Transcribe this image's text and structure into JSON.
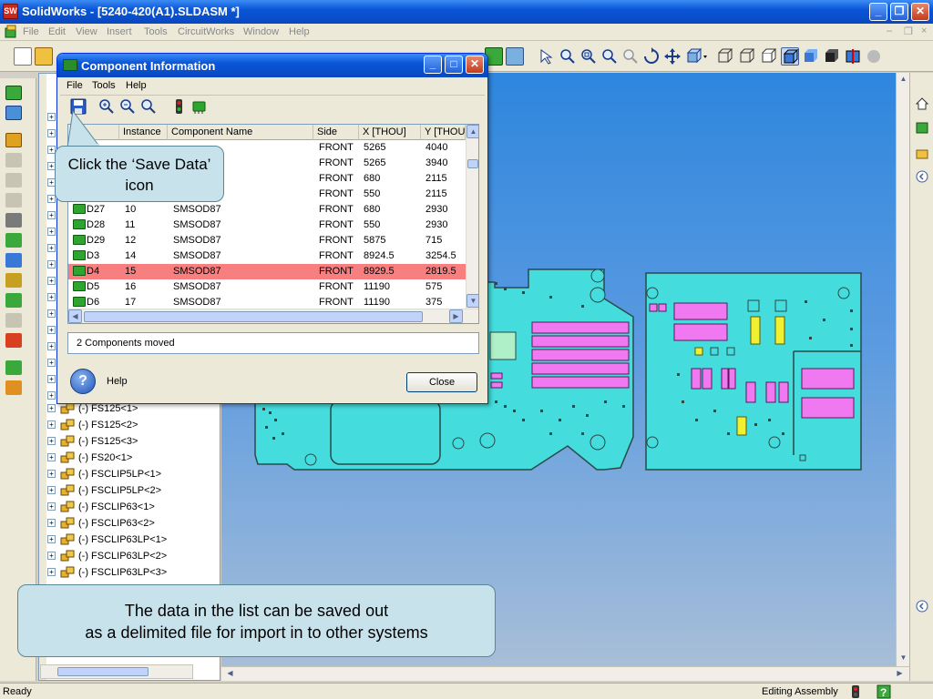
{
  "window": {
    "app_icon_text": "SW",
    "title": "SolidWorks - [5240-420(A1).SLDASM *]"
  },
  "menubar": {
    "items": [
      "File",
      "Edit",
      "View",
      "Insert",
      "Tools",
      "CircuitWorks",
      "Window",
      "Help"
    ]
  },
  "tree": {
    "items": [
      "(-) FS125<1>",
      "(-) FS125<2>",
      "(-) FS125<3>",
      "(-) FS20<1>",
      "(-) FSCLIP5LP<1>",
      "(-) FSCLIP5LP<2>",
      "(-) FSCLIP63<1>",
      "(-) FSCLIP63<2>",
      "(-) FSCLIP63LP<1>",
      "(-) FSCLIP63LP<2>",
      "(-) FSCLIP63LP<3>"
    ]
  },
  "dialog": {
    "title": "Component Information",
    "menu": [
      "File",
      "Tools",
      "Help"
    ],
    "columns": [
      "R",
      "Instance",
      "Component Name",
      "Side",
      "X [THOU]",
      "Y [THOU"
    ],
    "rows": [
      {
        "ref": "D27",
        "instance": "10",
        "name": "SMSOD87",
        "side": "FRONT",
        "x": "680",
        "y": "2930"
      },
      {
        "ref": "D28",
        "instance": "11",
        "name": "SMSOD87",
        "side": "FRONT",
        "x": "550",
        "y": "2930"
      },
      {
        "ref": "D29",
        "instance": "12",
        "name": "SMSOD87",
        "side": "FRONT",
        "x": "5875",
        "y": "715"
      },
      {
        "ref": "D3",
        "instance": "14",
        "name": "SMSOD87",
        "side": "FRONT",
        "x": "8924.5",
        "y": "3254.5"
      },
      {
        "ref": "D4",
        "instance": "15",
        "name": "SMSOD87",
        "side": "FRONT",
        "x": "8929.5",
        "y": "2819.5",
        "selected": true
      },
      {
        "ref": "D5",
        "instance": "16",
        "name": "SMSOD87",
        "side": "FRONT",
        "x": "11190",
        "y": "575"
      },
      {
        "ref": "D6",
        "instance": "17",
        "name": "SMSOD87",
        "side": "FRONT",
        "x": "11190",
        "y": "375"
      }
    ],
    "partial_rows": [
      {
        "side": "FRONT",
        "x": "5265",
        "y": "3940"
      },
      {
        "side": "FRONT",
        "x": "680",
        "y": "2115"
      },
      {
        "side": "FRONT",
        "x": "550",
        "y": "2115"
      }
    ],
    "top_row_fragment": {
      "side": "FRONT",
      "x": "5265",
      "y": "4040"
    },
    "status": "2 Components moved",
    "help_label": "Help",
    "close_label": "Close"
  },
  "callouts": {
    "save_icon": "Click the ‘Save Data’ icon",
    "data_line1": "The data in the list can be saved out",
    "data_line2": "as a delimited file for import in to other systems"
  },
  "statusbar": {
    "left": "Ready",
    "right": "Editing Assembly"
  },
  "colors": {
    "board": "#44dcdc",
    "pad_magenta": "#f078f0",
    "highlight_row": "#f77f7f",
    "callout": "#c8e2ec"
  }
}
